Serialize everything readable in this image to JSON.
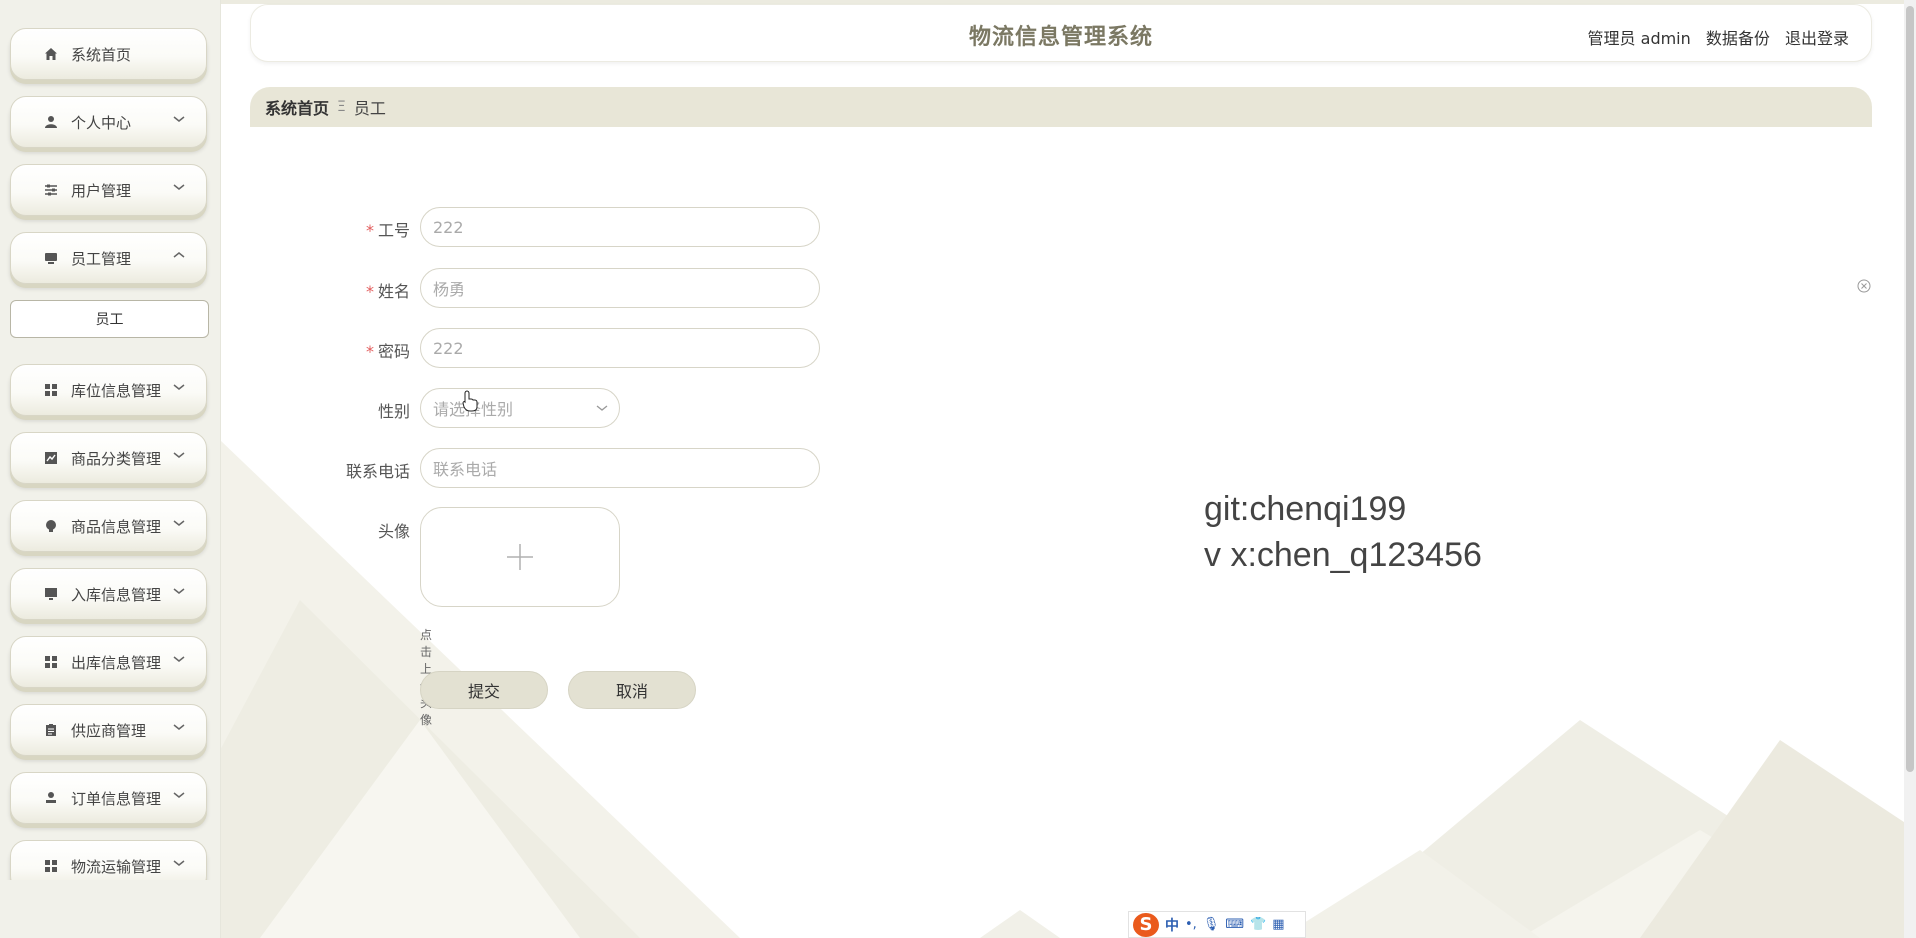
{
  "header": {
    "title": "物流信息管理系统",
    "user": "管理员 admin",
    "backup": "数据备份",
    "logout": "退出登录"
  },
  "sidebar": {
    "items": [
      {
        "label": "系统首页",
        "icon": "home-icon"
      },
      {
        "label": "个人中心",
        "icon": "user-icon"
      },
      {
        "label": "用户管理",
        "icon": "sliders-icon"
      },
      {
        "label": "员工管理",
        "icon": "monitor-icon"
      },
      {
        "label": "库位信息管理",
        "icon": "grid-icon"
      },
      {
        "label": "商品分类管理",
        "icon": "chart-icon"
      },
      {
        "label": "商品信息管理",
        "icon": "bulb-icon"
      },
      {
        "label": "入库信息管理",
        "icon": "desktop-icon"
      },
      {
        "label": "出库信息管理",
        "icon": "grid-icon"
      },
      {
        "label": "供应商管理",
        "icon": "clipboard-icon"
      },
      {
        "label": "订单信息管理",
        "icon": "person-icon"
      },
      {
        "label": "物流运输管理",
        "icon": "grid-icon"
      }
    ],
    "sub_item": "员工"
  },
  "breadcrumb": {
    "home": "系统首页",
    "separator": "Ξ",
    "current": "员工"
  },
  "form": {
    "job_no": {
      "label": "工号",
      "value": "222"
    },
    "name": {
      "label": "姓名",
      "value": "杨勇"
    },
    "password": {
      "label": "密码",
      "value": "222"
    },
    "gender": {
      "label": "性别",
      "placeholder": "请选择性别"
    },
    "phone": {
      "label": "联系电话",
      "placeholder": "联系电话"
    },
    "avatar": {
      "label": "头像",
      "hint": "点击上传头像"
    },
    "submit": "提交",
    "cancel": "取消"
  },
  "watermark": {
    "line1": "git:chenqi199",
    "line2": "v x:chen_q123456"
  },
  "ime": {
    "lang": "中",
    "logo": "S"
  },
  "colors": {
    "accent": "#e8e6d7",
    "title": "#7b7863",
    "required": "#e25c5c"
  }
}
